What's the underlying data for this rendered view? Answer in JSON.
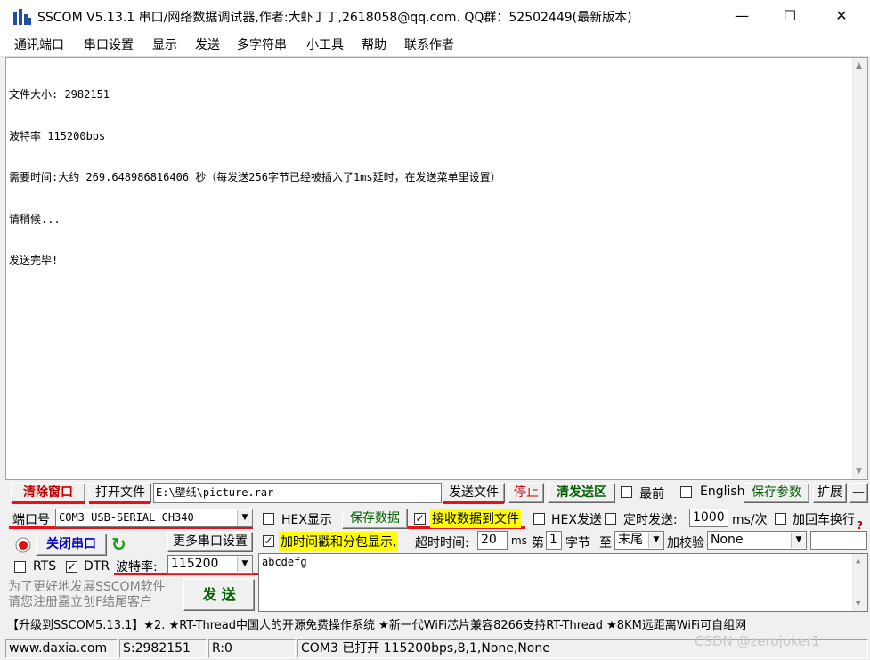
{
  "window": {
    "title": "SSCOM V5.13.1 串口/网络数据调试器,作者:大虾丁丁,2618058@qq.com. QQ群：52502449(最新版本)",
    "minimize": "—",
    "maximize": "☐",
    "close": "✕"
  },
  "menu": [
    "通讯端口",
    "串口设置",
    "显示",
    "发送",
    "多字符串",
    "小工具",
    "帮助",
    "联系作者"
  ],
  "receive": {
    "lines": [
      "文件大小: 2982151",
      "波特率 115200bps",
      "需要时间:大约 269.648986816406 秒（每发送256字节已经被插入了1ms延时，在发送菜单里设置）",
      "请稍候...",
      "发送完毕!"
    ]
  },
  "toolbar1": {
    "clear_window": "清除窗口",
    "open_file": "打开文件",
    "file_path": "E:\\壁纸\\picture.rar",
    "send_file": "发送文件",
    "stop": "停止",
    "clear_send": "清发送区",
    "topmost": "最前",
    "english": "English",
    "save_params": "保存参数",
    "expand": "扩展",
    "collapse": "—"
  },
  "port": {
    "port_label": "端口号",
    "port_value": "COM3 USB-SERIAL CH340",
    "close_port": "关闭串口",
    "more_settings": "更多串口设置",
    "rts": "RTS",
    "dtr": "DTR",
    "baud_label": "波特率:",
    "baud_value": "115200"
  },
  "options": {
    "hex_display": "HEX显示",
    "save_data": "保存数据",
    "recv_to_file": "接收数据到文件",
    "hex_send": "HEX发送",
    "timed_send": "定时发送:",
    "interval": "1000",
    "interval_unit": "ms/次",
    "append_newline": "加回车换行",
    "timestamp_pack": "加时间戳和分包显示,",
    "timeout_label": "超时时间:",
    "timeout_value": "20",
    "timeout_unit": "ms",
    "byte_pos_label": "第",
    "byte_pos_value": "1",
    "byte_label": "字节",
    "to_label": "至",
    "end_value": "末尾",
    "checksum_label": "加校验",
    "checksum_value": "None",
    "help": "?"
  },
  "send": {
    "text": "abcdefg",
    "button": "发 送",
    "promo": [
      "为了更好地发展SSCOM软件",
      "请您注册嘉立创F结尾客户"
    ]
  },
  "ticker": "【升级到SSCOM5.13.1】★2. ★RT-Thread中国人的开源免费操作系统 ★新一代WiFi芯片兼容8266支持RT-Thread ★8KM远距离WiFi可自组网",
  "status": {
    "website": "www.daxia.com",
    "sent": "S:2982151",
    "received": "R:0",
    "port_state": "COM3 已打开  115200bps,8,1,None,None",
    "watermark": "CSDN @zerojoker1"
  },
  "colors": {
    "accent_red": "#e8101b",
    "button_text_red": "#c00000",
    "button_text_blue": "#0000c0",
    "button_text_green": "#006000",
    "highlight_yellow": "#ffff00"
  }
}
